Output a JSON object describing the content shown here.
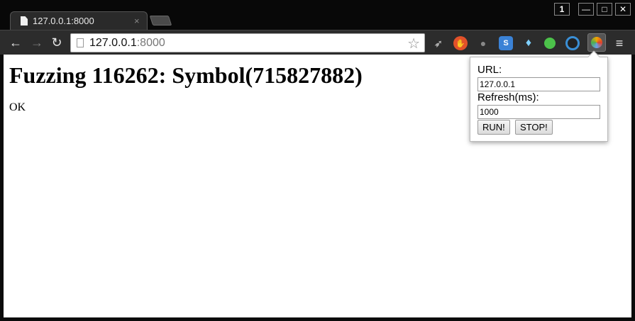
{
  "browser": {
    "tab_title": "127.0.0.1:8000",
    "tab_close": "×",
    "window_count": "1",
    "min_glyph": "—",
    "max_glyph": "□",
    "close_glyph": "✕",
    "address_host": "127.0.0.1",
    "address_port": ":8000",
    "star_glyph": "☆",
    "back_glyph": "←",
    "forward_glyph": "→",
    "reload_glyph": "↻",
    "menu_glyph": "≡",
    "extensions": [
      "feather-icon",
      "shield-hand-icon",
      "gray-extension-icon",
      "skype-icon",
      "diamond-icon",
      "green-circle-icon",
      "ring-icon",
      "fuzzer-ball-icon"
    ]
  },
  "page": {
    "heading": "Fuzzing 116262: Symbol(715827882)",
    "status": "OK"
  },
  "popup": {
    "url_label": "URL:",
    "url_value": "127.0.0.1",
    "refresh_label": "Refresh(ms):",
    "refresh_value": "1000",
    "run_label": "RUN!",
    "stop_label": "STOP!"
  }
}
